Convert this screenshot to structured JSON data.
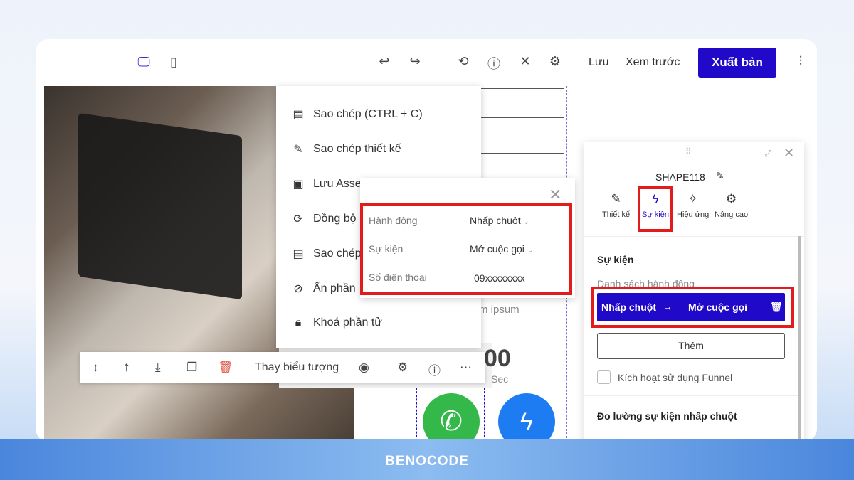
{
  "brand": {
    "logo": "BENOCODE",
    "accent": "#2009c9",
    "highlight": "#e31b1b"
  },
  "topbar": {
    "icons": [
      "desktop-icon",
      "tablet-icon",
      "undo-icon",
      "redo-icon",
      "history-icon",
      "help-icon",
      "tools-icon",
      "settings-icon",
      "sliders-icon"
    ],
    "save": "Lưu",
    "preview": "Xem trước",
    "publish": "Xuất bản"
  },
  "context_menu": {
    "items": [
      "Sao chép (CTRL + C)",
      "Sao chép thiết kế",
      "Lưu Asse",
      "Đồng bộ",
      "Sao chép",
      "Ẩn phần",
      "Khoá phần tử"
    ]
  },
  "event_popup": {
    "rows": [
      {
        "label": "Hành động",
        "value": "Nhấp chuột"
      },
      {
        "label": "Sự kiện",
        "value": "Mở cuộc gọi"
      },
      {
        "label": "Số điện thoại",
        "value": "09xxxxxxxx"
      }
    ]
  },
  "canvas": {
    "lorem": "m ipsum",
    "timer_digits": "00",
    "timer_unit": "Sec"
  },
  "element_toolbar": {
    "change_icon": "Thay biểu tượng"
  },
  "panel": {
    "title": "SHAPE118",
    "tabs": [
      "Thiết kế",
      "Sự kiện",
      "Hiệu ứng",
      "Nâng cao"
    ],
    "active_tab": "Sự kiện",
    "section": "Sự kiện",
    "list_label": "Danh sách hành động",
    "action_trigger": "Nhấp chuột",
    "action_event": "Mở cuộc gọi",
    "add": "Thêm",
    "funnel": "Kích hoạt sử dụng Funnel",
    "funnel_checked": false,
    "measure": "Đo lường sự kiện nhấp chuột"
  }
}
